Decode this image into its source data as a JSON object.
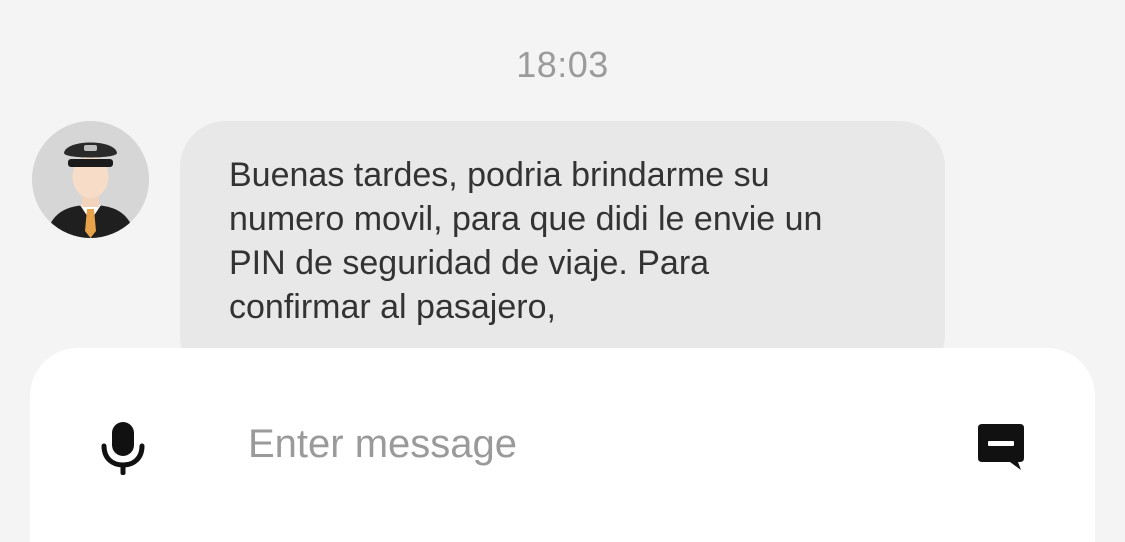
{
  "chat": {
    "timestamp": "18:03",
    "messages": [
      {
        "sender": "driver",
        "avatar_icon": "driver-avatar-icon",
        "text": "Buenas tardes, podria brindarme su\nnumero movil, para que didi le envie un\nPIN de seguridad de viaje. Para\nconfirmar al pasajero,"
      }
    ]
  },
  "composer": {
    "mic_icon": "microphone-icon",
    "placeholder": "Enter message",
    "value": "",
    "quick_reply_icon": "quick-message-icon"
  },
  "colors": {
    "background": "#f4f4f4",
    "bubble": "#e8e8e8",
    "composer": "#ffffff",
    "timestamp": "#9b9b9b",
    "text": "#333333",
    "tie": "#e8a24a"
  }
}
